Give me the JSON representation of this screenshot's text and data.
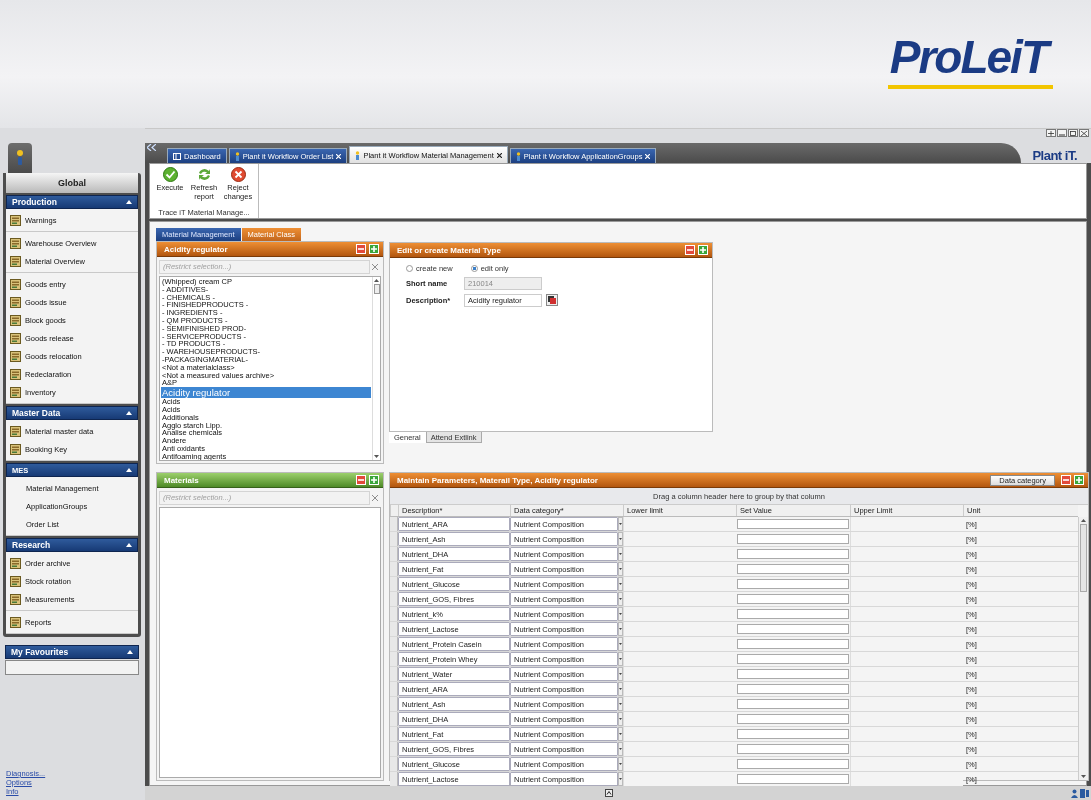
{
  "banner": {
    "logo": "ProLeiT"
  },
  "sidebar": {
    "header": "Global",
    "sections": [
      {
        "title": "Production",
        "expanded": true,
        "groups": [
          [
            {
              "label": "Warnings",
              "kind": "icon"
            }
          ],
          [
            {
              "label": "Warehouse Overview",
              "kind": "icon"
            },
            {
              "label": "Material Overview",
              "kind": "icon"
            }
          ],
          [
            {
              "label": "Goods entry",
              "kind": "icon"
            },
            {
              "label": "Goods issue",
              "kind": "icon"
            },
            {
              "label": "Block goods",
              "kind": "icon"
            },
            {
              "label": "Goods release",
              "kind": "icon"
            },
            {
              "label": "Goods relocation",
              "kind": "icon"
            },
            {
              "label": "Redeclaration",
              "kind": "icon"
            },
            {
              "label": "Inventory",
              "kind": "icon"
            }
          ]
        ]
      },
      {
        "title": "Master Data",
        "expanded": true,
        "groups": [
          [
            {
              "label": "Material master data",
              "kind": "icon"
            },
            {
              "label": "Booking Key",
              "kind": "icon"
            }
          ]
        ]
      },
      {
        "title": "MES",
        "expanded": true,
        "groups": [
          [
            {
              "label": "Material Management",
              "kind": "text"
            },
            {
              "label": "ApplicationGroups",
              "kind": "text"
            },
            {
              "label": "Order List",
              "kind": "text"
            }
          ]
        ]
      },
      {
        "title": "Research",
        "expanded": true,
        "groups": [
          [
            {
              "label": "Order archive",
              "kind": "icon"
            },
            {
              "label": "Stock rotation",
              "kind": "icon"
            },
            {
              "label": "Measurements",
              "kind": "icon"
            }
          ],
          [
            {
              "label": "Reports",
              "kind": "icon"
            }
          ]
        ]
      }
    ],
    "favourites": {
      "title": "My Favourites",
      "expanded": true
    },
    "links": [
      "Diagnosis...",
      "Options",
      "Info"
    ]
  },
  "app_logo": "Plant iT.",
  "tabs": [
    {
      "label": "Dashboard",
      "selected": false,
      "closable": false
    },
    {
      "label": "Plant it Workflow Order List",
      "selected": false,
      "closable": true
    },
    {
      "label": "Plant it Workflow Material Management",
      "selected": true,
      "closable": true
    },
    {
      "label": "Plant it Workflow ApplicationGroups",
      "selected": false,
      "closable": true
    }
  ],
  "toolbar": {
    "buttons": [
      {
        "label": "Execute",
        "kind": "execute"
      },
      {
        "label": "Refresh report",
        "kind": "refresh"
      },
      {
        "label": "Reject changes",
        "kind": "reject"
      }
    ],
    "group_label": "Trace iT Material Manage..."
  },
  "class_panel": {
    "tabs": [
      {
        "label": "Material Management",
        "selected": false
      },
      {
        "label": "Material Class",
        "selected": true
      }
    ],
    "title": "Acidity regulator",
    "filter": {
      "placeholder": "(Restrict selection...)"
    },
    "items": [
      {
        "label": "(Whipped) cream CP",
        "selected": false
      },
      {
        "label": "- ADDITIVES-",
        "selected": false
      },
      {
        "label": "- CHEMICALS -",
        "selected": false
      },
      {
        "label": "- FINISHEDPRODUCTS -",
        "selected": false
      },
      {
        "label": "- INGREDIENTS -",
        "selected": false
      },
      {
        "label": "- QM PRODUCTS -",
        "selected": false
      },
      {
        "label": "- SEMIFINISHED PROD-",
        "selected": false
      },
      {
        "label": "- SERVICEPRODUCTS -",
        "selected": false
      },
      {
        "label": "- TD PRODUCTS -",
        "selected": false
      },
      {
        "label": "- WAREHOUSEPRODUCTS-",
        "selected": false
      },
      {
        "label": "-PACKAGINGMATERIAL-",
        "selected": false
      },
      {
        "label": "<Not a materialclass>",
        "selected": false
      },
      {
        "label": "<Not a measured values archive>",
        "selected": false
      },
      {
        "label": "A&P",
        "selected": false
      },
      {
        "label": "Acidity regulator",
        "selected": true
      },
      {
        "label": "Acids",
        "selected": false
      },
      {
        "label": "Acids",
        "selected": false
      },
      {
        "label": "Additionals",
        "selected": false
      },
      {
        "label": "Agglo starch Lipp.",
        "selected": false
      },
      {
        "label": "Analise chemicals",
        "selected": false
      },
      {
        "label": "Andere",
        "selected": false
      },
      {
        "label": "Anti oxidants",
        "selected": false
      },
      {
        "label": "Antifoaming agents",
        "selected": false
      }
    ]
  },
  "edit_panel": {
    "title": "Edit or create Material Type",
    "modes": [
      {
        "label": "create new",
        "selected": false
      },
      {
        "label": "edit only",
        "selected": true
      }
    ],
    "fields": [
      {
        "label": "Short name",
        "value": "210014",
        "disabled": true
      },
      {
        "label": "Description*",
        "value": "Acidity regulator",
        "disabled": false
      }
    ],
    "tabs": [
      {
        "label": "General",
        "selected": true
      },
      {
        "label": "Attend Extlink",
        "selected": false
      }
    ]
  },
  "materials_panel": {
    "title": "Materials",
    "filter": {
      "placeholder": "(Restrict selection...)"
    }
  },
  "params_panel": {
    "title": "Maintain Parameters, Materail Type, Acidity regulator",
    "button": "Data category",
    "group_hint": "Drag a column header here to group by that column",
    "columns": [
      "Description*",
      "Data category*",
      "Lower limit",
      "Set Value",
      "Upper Limit",
      "Unit"
    ],
    "rows": [
      {
        "description": "Nutrient_ARA",
        "data_category": "Nutrient Composition",
        "unit": "[%]"
      },
      {
        "description": "Nutrient_Ash",
        "data_category": "Nutrient Composition",
        "unit": "[%]"
      },
      {
        "description": "Nutrient_DHA",
        "data_category": "Nutrient Composition",
        "unit": "[%]"
      },
      {
        "description": "Nutrient_Fat",
        "data_category": "Nutrient Composition",
        "unit": "[%]"
      },
      {
        "description": "Nutrient_Glucose",
        "data_category": "Nutrient Composition",
        "unit": "[%]"
      },
      {
        "description": "Nutrient_GOS, Fibres",
        "data_category": "Nutrient Composition",
        "unit": "[%]"
      },
      {
        "description": "Nutrient_k%",
        "data_category": "Nutrient Composition",
        "unit": "[%]"
      },
      {
        "description": "Nutrient_Lactose",
        "data_category": "Nutrient Composition",
        "unit": "[%]"
      },
      {
        "description": "Nutrient_Protein Casein",
        "data_category": "Nutrient Composition",
        "unit": "[%]"
      },
      {
        "description": "Nutrient_Protein Whey",
        "data_category": "Nutrient Composition",
        "unit": "[%]"
      },
      {
        "description": "Nutrient_Water",
        "data_category": "Nutrient Composition",
        "unit": "[%]"
      },
      {
        "description": "Nutrient_ARA",
        "data_category": "Nutrient Composition",
        "unit": "[%]"
      },
      {
        "description": "Nutrient_Ash",
        "data_category": "Nutrient Composition",
        "unit": "[%]"
      },
      {
        "description": "Nutrient_DHA",
        "data_category": "Nutrient Composition",
        "unit": "[%]"
      },
      {
        "description": "Nutrient_Fat",
        "data_category": "Nutrient Composition",
        "unit": "[%]"
      },
      {
        "description": "Nutrient_GOS, Fibres",
        "data_category": "Nutrient Composition",
        "unit": "[%]"
      },
      {
        "description": "Nutrient_Glucose",
        "data_category": "Nutrient Composition",
        "unit": "[%]"
      },
      {
        "description": "Nutrient_Lactose",
        "data_category": "Nutrient Composition",
        "unit": "[%]"
      }
    ]
  }
}
